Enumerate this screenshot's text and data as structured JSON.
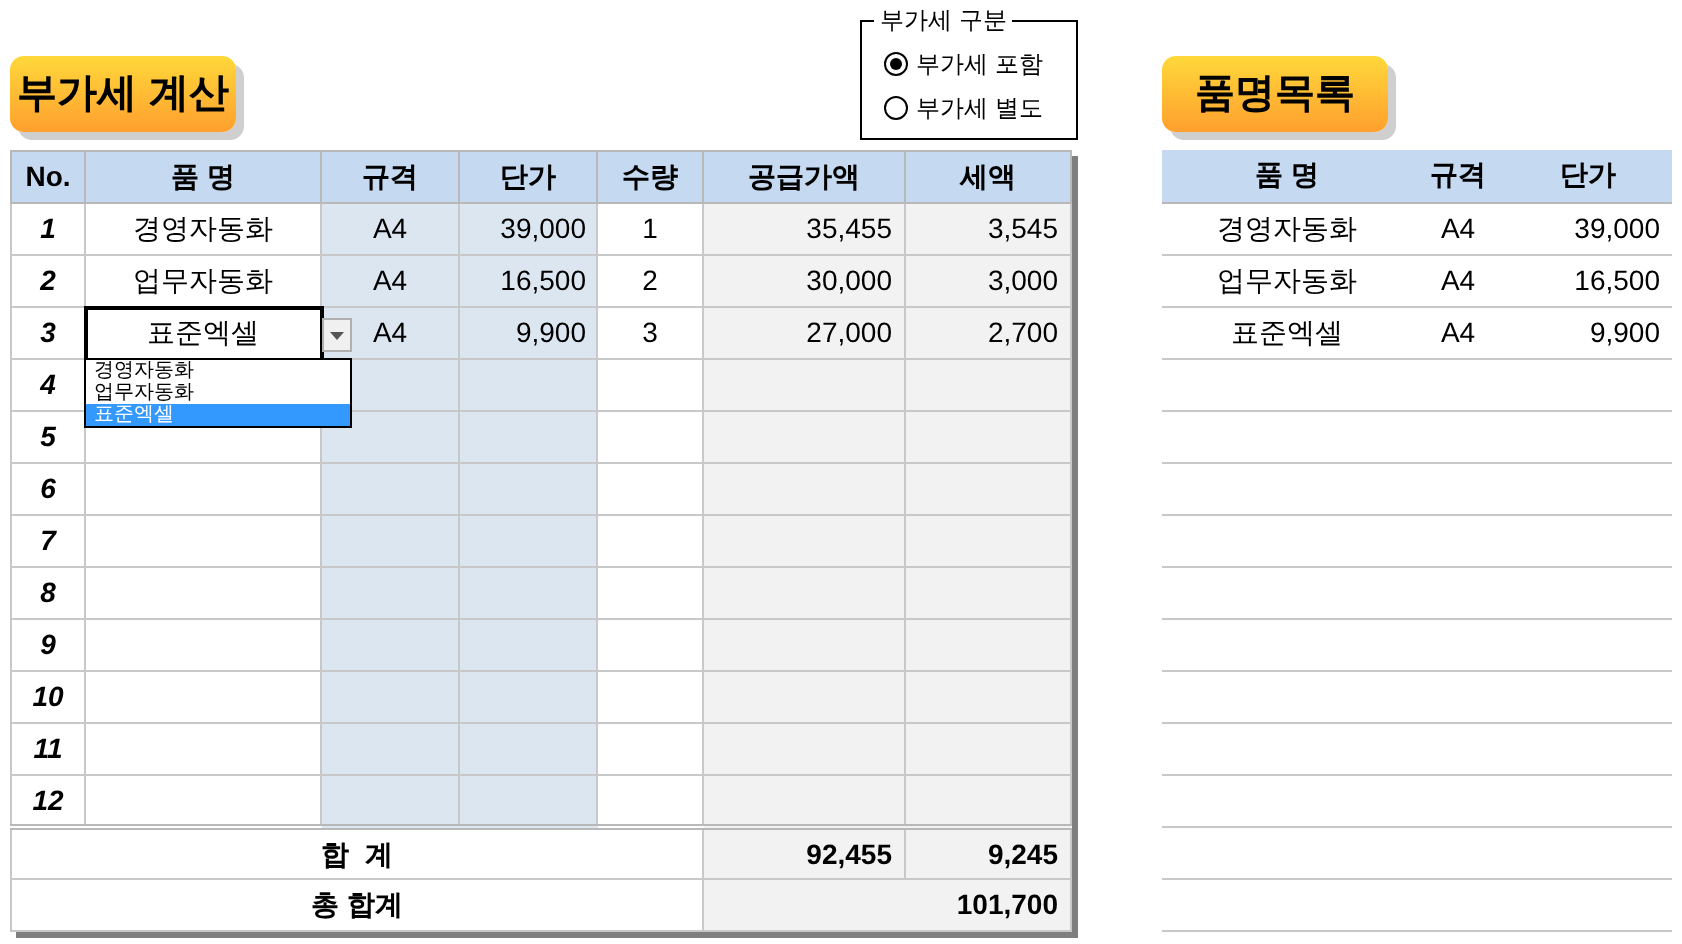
{
  "calc_panel": {
    "title": "부가세 계산"
  },
  "vat_option": {
    "legend": "부가세 구분",
    "options": [
      {
        "label": "부가세 포함",
        "selected": true
      },
      {
        "label": "부가세 별도",
        "selected": false
      }
    ]
  },
  "calc_table": {
    "columns": [
      "No.",
      "품 명",
      "규격",
      "단가",
      "수량",
      "공급가액",
      "세액"
    ],
    "rows": [
      {
        "no": "1",
        "item": "경영자동화",
        "spec": "A4",
        "price": "39,000",
        "qty": "1",
        "supply": "35,455",
        "tax": "3,545",
        "active": false
      },
      {
        "no": "2",
        "item": "업무자동화",
        "spec": "A4",
        "price": "16,500",
        "qty": "2",
        "supply": "30,000",
        "tax": "3,000",
        "active": false
      },
      {
        "no": "3",
        "item": "표준엑셀",
        "spec": "A4",
        "price": "9,900",
        "qty": "3",
        "supply": "27,000",
        "tax": "2,700",
        "active": true
      },
      {
        "no": "4",
        "active": false
      },
      {
        "no": "5",
        "active": false
      },
      {
        "no": "6",
        "active": false
      },
      {
        "no": "7",
        "active": false
      },
      {
        "no": "8",
        "active": false
      },
      {
        "no": "9",
        "active": false
      },
      {
        "no": "10",
        "active": false
      },
      {
        "no": "11",
        "active": false
      },
      {
        "no": "12",
        "active": false
      }
    ],
    "total": {
      "label": "합  계",
      "supply": "92,455",
      "tax": "9,245"
    },
    "grand_total": {
      "label": "총 합계",
      "value": "101,700"
    }
  },
  "dropdown": {
    "options": [
      {
        "label": "경영자동화",
        "selected": false
      },
      {
        "label": "업무자동화",
        "selected": false
      },
      {
        "label": "표준엑셀",
        "selected": true
      }
    ]
  },
  "product_list": {
    "title": "품명목록",
    "columns": [
      "품 명",
      "규격",
      "단가"
    ],
    "rows": [
      {
        "item": "경영자동화",
        "spec": "A4",
        "price": "39,000"
      },
      {
        "item": "업무자동화",
        "spec": "A4",
        "price": "16,500"
      },
      {
        "item": "표준엑셀",
        "spec": "A4",
        "price": "9,900"
      }
    ]
  }
}
